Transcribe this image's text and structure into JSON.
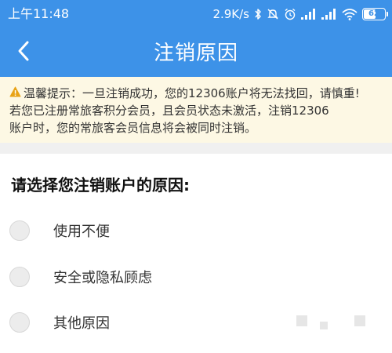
{
  "status_bar": {
    "time": "上午11:48",
    "net_speed": "2.9K/s",
    "battery_level": "62",
    "icons": [
      "bluetooth-icon",
      "mute-icon",
      "alarm-icon",
      "signal-icon",
      "signal-icon",
      "wifi-icon",
      "battery-icon"
    ]
  },
  "header": {
    "title": "注销原因",
    "back_icon": "chevron-left-icon"
  },
  "notice": {
    "icon": "warning-icon",
    "lines": [
      "温馨提示：一旦注销成功，您的12306账户将无法找回，请慎重!",
      "若您已注册常旅客积分会员，且会员状态未激活，注销12306",
      "账户时，您的常旅客会员信息将会被同时注销。"
    ]
  },
  "form": {
    "title": "请选择您注销账户的原因:",
    "options": [
      "使用不便",
      "安全或隐私顾虑",
      "其他原因"
    ]
  },
  "colors": {
    "primary": "#3d92e8",
    "notice_bg": "#fdf8e4",
    "warning": "#e8a317",
    "radio_bg": "#ececec"
  }
}
